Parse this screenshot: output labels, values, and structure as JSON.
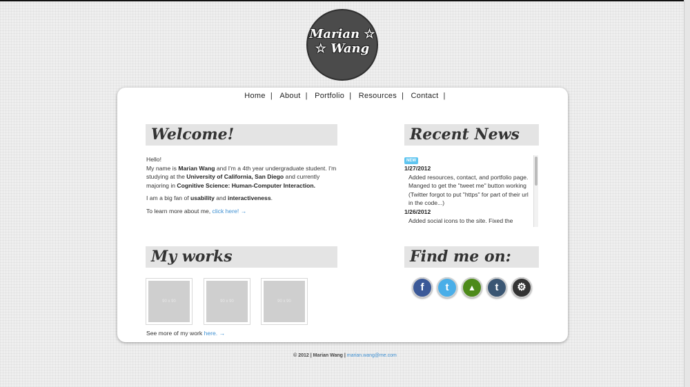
{
  "logo": {
    "line1": "Marian",
    "line2": "Wang"
  },
  "nav": {
    "items": [
      "Home",
      "About",
      "Portfolio",
      "Resources",
      "Contact"
    ]
  },
  "welcome": {
    "heading": "Welcome!",
    "hello": "Hello!",
    "intro_1": "My name is ",
    "name": "Marian Wang",
    "intro_2": " and I'm a 4th year undergraduate student. I'm studying at the ",
    "school": "University of California, San Diego",
    "intro_3": " and currently majoring in ",
    "major": "Cognitive Science: Human-Computer Interaction.",
    "fan_1": "I am a big fan of ",
    "fan_usability": "usability",
    "fan_2": " and ",
    "fan_interactiveness": "interactiveness",
    "fan_3": ".",
    "learn_more": "To learn more about me, ",
    "learn_link": "click here! →"
  },
  "news": {
    "heading": "Recent News",
    "badge": "NEW",
    "items": [
      {
        "date": "1/27/2012",
        "text": "Added resources, contact, and portfolio page. Manged to get the \"tweet me\" button working (Twitter forgot to put \"https\" for part of their url in the code...)"
      },
      {
        "date": "1/26/2012",
        "text": "Added social icons to the site. Fixed the header."
      }
    ]
  },
  "works": {
    "heading": "My works",
    "thumb_label": "90 x 90",
    "see_more": "See more of my work ",
    "see_more_link": "here. →"
  },
  "find": {
    "heading": "Find me on:",
    "icons": [
      {
        "name": "facebook-icon",
        "glyph": "f",
        "color": "#3b5998"
      },
      {
        "name": "twitter-icon",
        "glyph": "t",
        "color": "#4aaee8"
      },
      {
        "name": "forrst-icon",
        "glyph": "▲",
        "color": "#4d8a1a"
      },
      {
        "name": "tumblr-icon",
        "glyph": "t",
        "color": "#3a5673"
      },
      {
        "name": "steam-icon",
        "glyph": "⚙",
        "color": "#333333"
      }
    ]
  },
  "footer": {
    "copyright": "© 2012 | Marian Wang | ",
    "email": "marian.wang@me.com"
  }
}
